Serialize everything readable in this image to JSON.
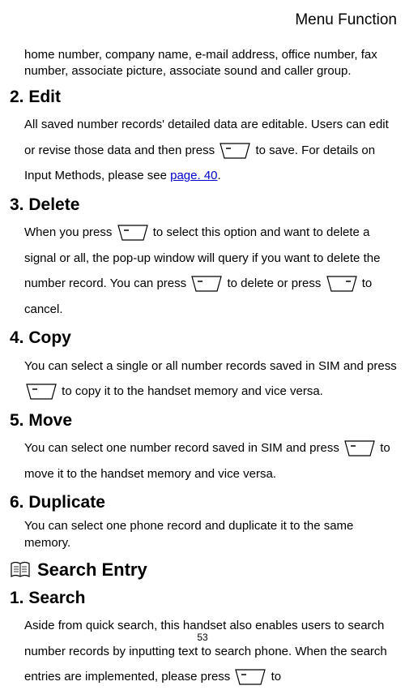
{
  "header": {
    "title": "Menu Function"
  },
  "intro": {
    "text": "home number, company name, e-mail address, office number, fax number, associate picture, associate sound and caller group."
  },
  "sections": {
    "edit": {
      "heading": "2. Edit",
      "p1_a": "All saved number records' detailed data are editable. Users can edit or revise those data and then press ",
      "p1_b": " to save. For details on Input Methods, please see ",
      "link": "page. 40",
      "p1_c": "."
    },
    "delete": {
      "heading": "3. Delete",
      "p1_a": "When you press ",
      "p1_b": " to select this option and want to delete a signal or all, the pop-up window will query if you want to delete the number record. You can press ",
      "p1_c": " to delete or press ",
      "p1_d": " to cancel."
    },
    "copy": {
      "heading": "4. Copy",
      "p1_a": "You can select a single or all number records saved in SIM and press ",
      "p1_b": " to copy it to the handset memory and vice versa."
    },
    "move": {
      "heading": "5. Move",
      "p1_a": "You can select one number record saved in SIM and press ",
      "p1_b": " to move it to the handset memory and vice versa."
    },
    "duplicate": {
      "heading": "6. Duplicate",
      "p1": "You can select one phone record and duplicate it to the same memory."
    },
    "search_entry": {
      "heading": "Search Entry"
    },
    "search": {
      "heading": "1. Search",
      "p1_a": "Aside from quick search, this handset also enables users to search number records by inputting text to search phone. When the search entries are implemented, please press ",
      "p1_b": " to"
    }
  },
  "footer": {
    "page_number": "53"
  }
}
